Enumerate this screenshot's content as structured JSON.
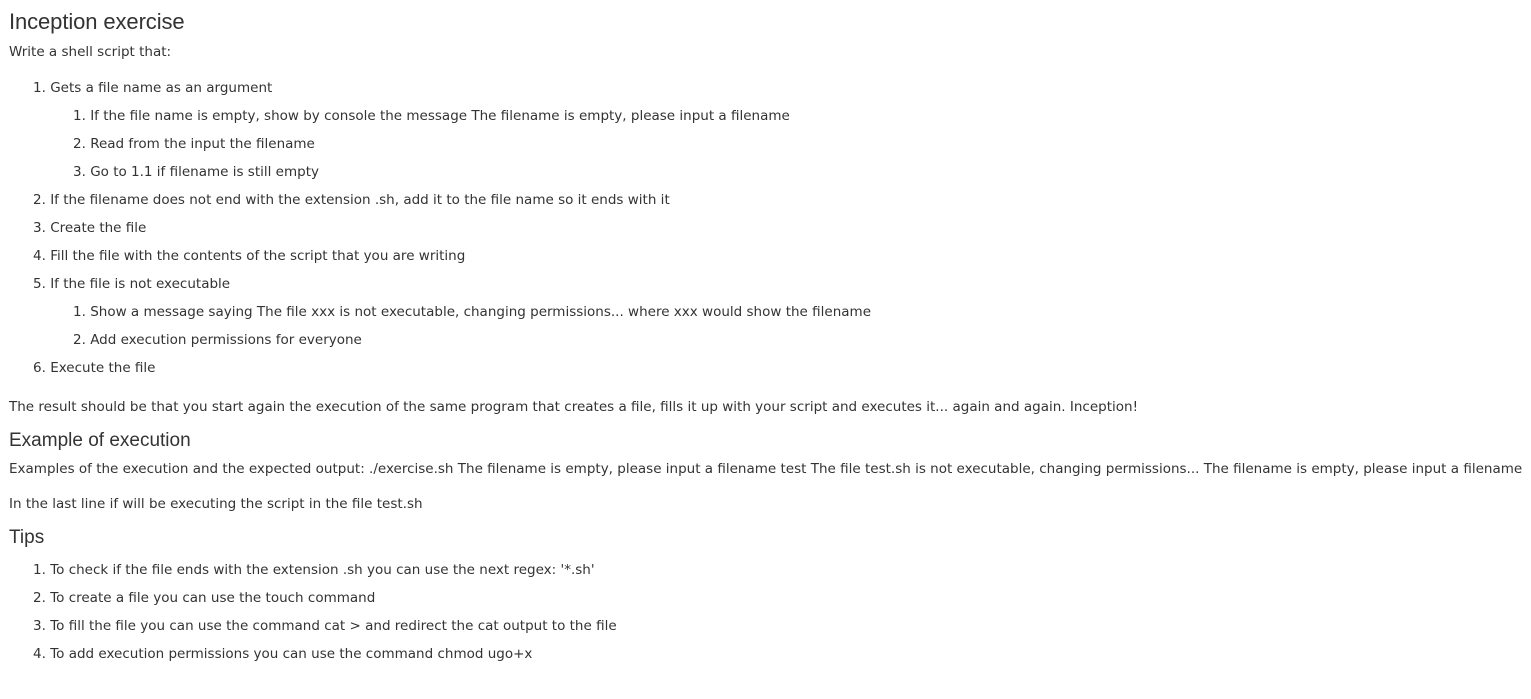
{
  "title": "Inception exercise",
  "intro": "Write a shell script that:",
  "steps": [
    {
      "num": "1.",
      "text": "Gets a file name as an argument",
      "sub": [
        {
          "num": "1.",
          "text": "If the file name is empty, show by console the message The filename is empty, please input a filename"
        },
        {
          "num": "2.",
          "text": "Read from the input the filename"
        },
        {
          "num": "3.",
          "text": "Go to 1.1 if filename is still empty"
        }
      ]
    },
    {
      "num": "2.",
      "text": "If the filename does not end with the extension .sh, add it to the file name so it ends with it"
    },
    {
      "num": "3.",
      "text": "Create the file"
    },
    {
      "num": "4.",
      "text": "Fill the file with the contents of the script that you are writing"
    },
    {
      "num": "5.",
      "text": "If the file is not executable",
      "sub": [
        {
          "num": "1.",
          "text": "Show a message saying The file xxx is not executable, changing permissions... where xxx would show the filename"
        },
        {
          "num": "2.",
          "text": "Add execution permissions for everyone"
        }
      ]
    },
    {
      "num": "6.",
      "text": "Execute the file"
    }
  ],
  "result": "The result should be that you start again the execution of the same program that creates a file, fills it up with your script and executes it... again and again. Inception!",
  "example_heading": "Example of execution",
  "example_text": "Examples of the execution and the expected output: ./exercise.sh The filename is empty, please input a filename test The file test.sh is not executable, changing permissions... The filename is empty, please input a filename",
  "last_line": "In the last line if will be executing the script in the file test.sh",
  "tips_heading": "Tips",
  "tips": [
    {
      "num": "1.",
      "text": "To check if the file ends with the extension .sh you can use the next regex: '*.sh'"
    },
    {
      "num": "2.",
      "text": "To create a file you can use the touch command"
    },
    {
      "num": "3.",
      "text": "To fill the file you can use the command cat > and redirect the cat output to the file"
    },
    {
      "num": "4.",
      "text": "To add execution permissions you can use the command chmod ugo+x"
    }
  ]
}
